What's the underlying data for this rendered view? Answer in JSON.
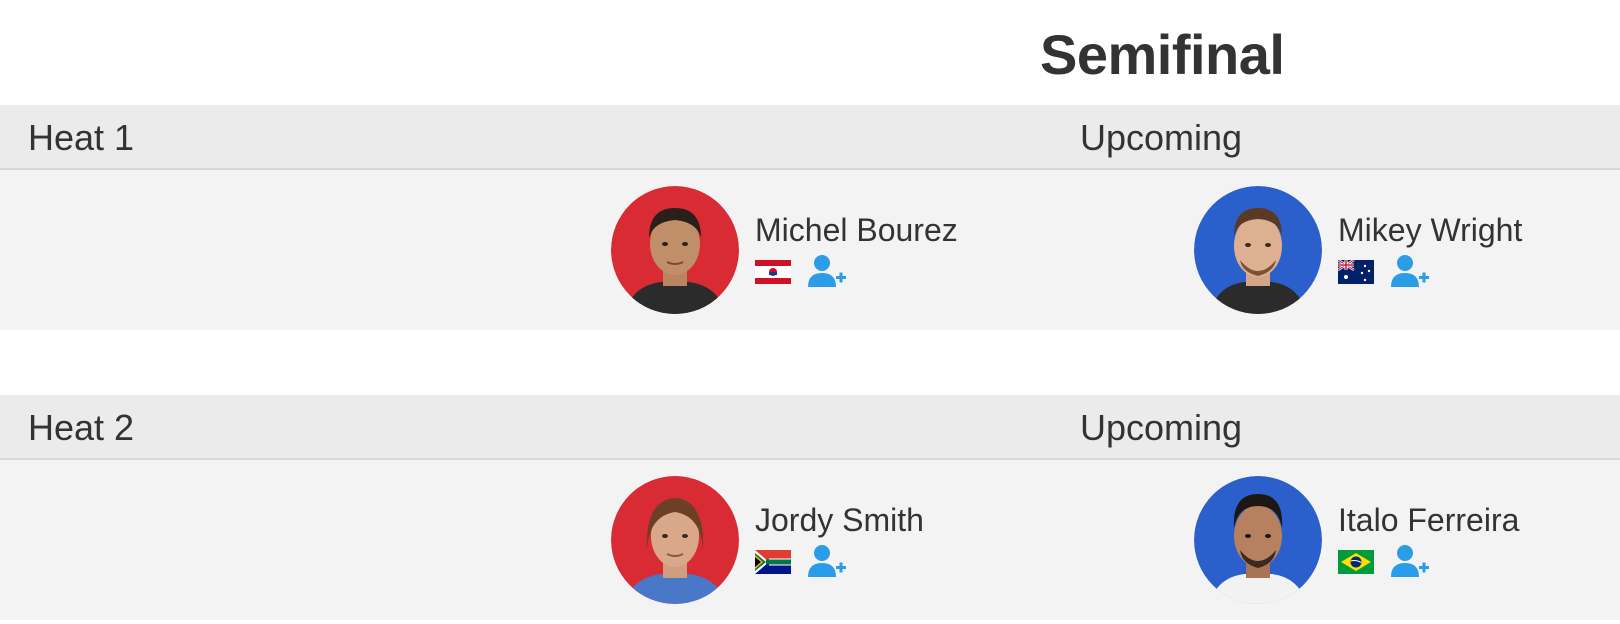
{
  "round": {
    "title": "Semifinal"
  },
  "heats": [
    {
      "name": "Heat 1",
      "status": "Upcoming",
      "athletes": [
        {
          "name": "Michel Bourez",
          "jersey_color": "#d92b33",
          "flag": "french-polynesia-flag"
        },
        {
          "name": "Mikey Wright",
          "jersey_color": "#2a5fcc",
          "flag": "australia-flag"
        }
      ]
    },
    {
      "name": "Heat 2",
      "status": "Upcoming",
      "athletes": [
        {
          "name": "Jordy Smith",
          "jersey_color": "#d92b33",
          "flag": "south-africa-flag"
        },
        {
          "name": "Italo Ferreira",
          "jersey_color": "#2a5fcc",
          "flag": "brazil-flag"
        }
      ]
    }
  ],
  "icons": {
    "follow": "follow-athlete-icon"
  },
  "colors": {
    "follow_icon": "#2b9ce8",
    "header_bg": "#ebebeb",
    "body_bg": "#f3f3f3"
  }
}
